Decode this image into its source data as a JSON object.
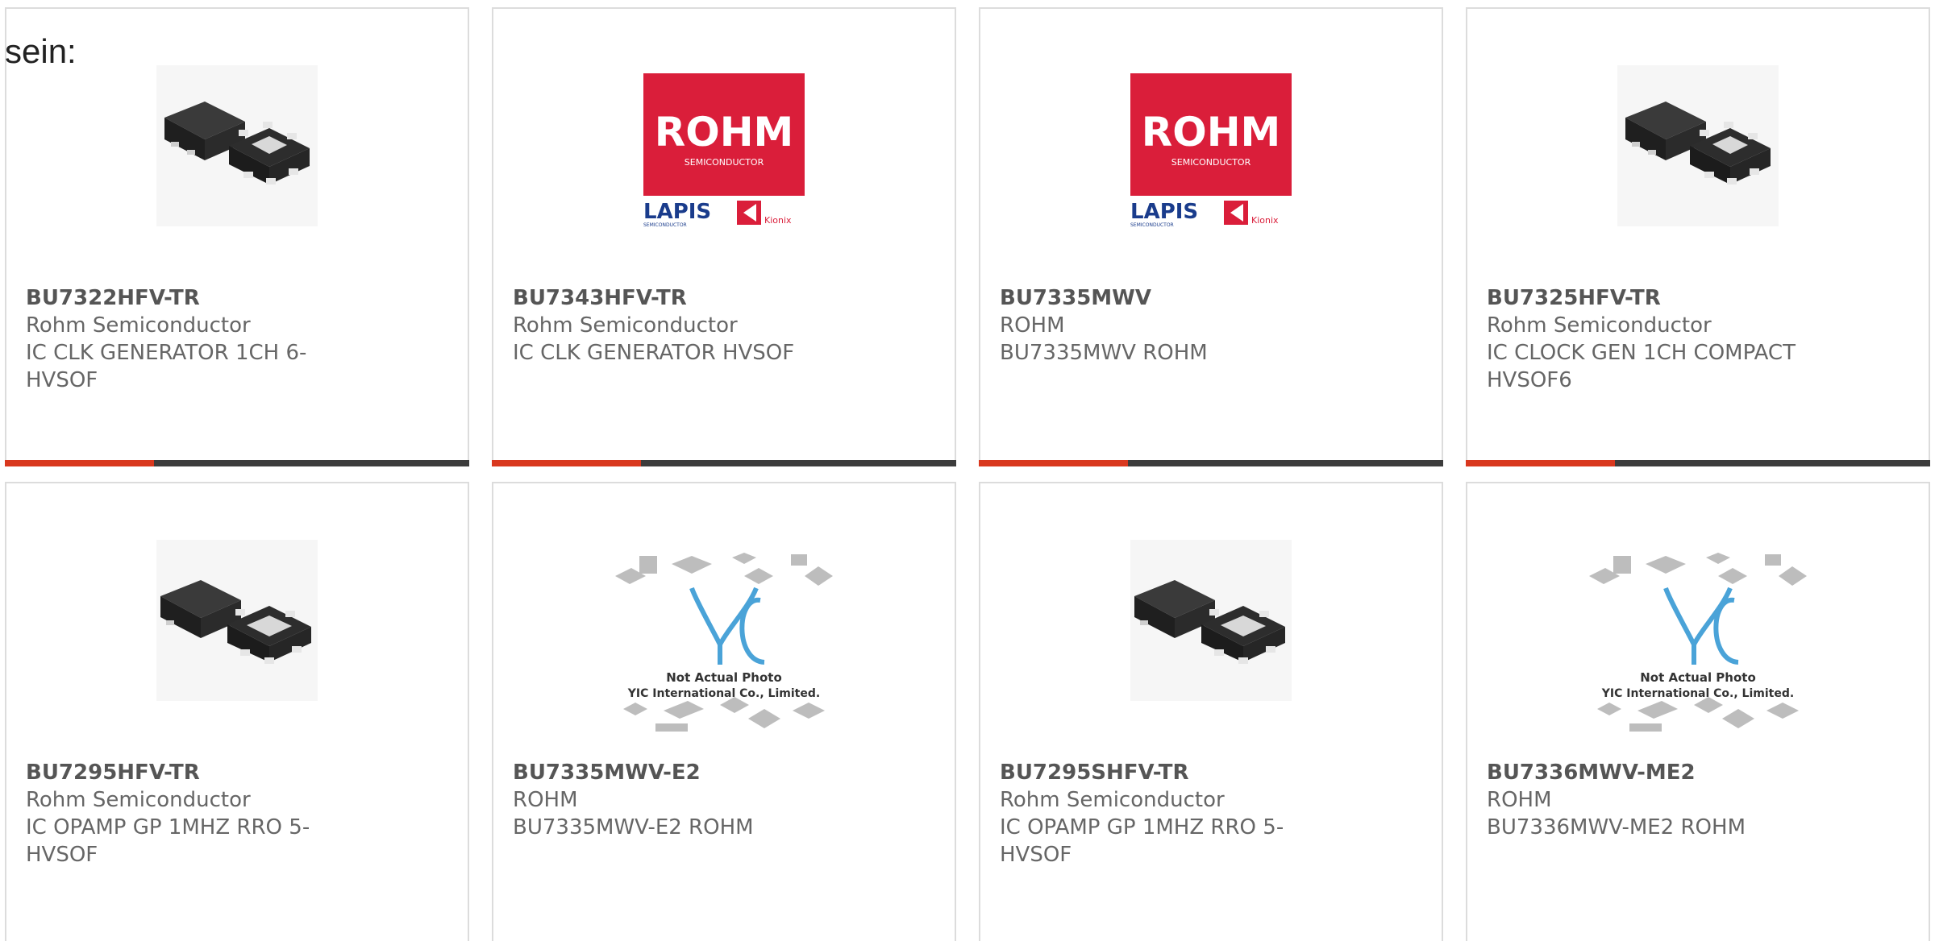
{
  "intro_text": "sein:",
  "colors": {
    "accent": "#d9381e",
    "bar_dark": "#3c3c3c",
    "rohm_red": "#da1e3a",
    "lapis_blue": "#1a3c8c",
    "yic_blue": "#4aa3d8"
  },
  "products": [
    {
      "part": "BU7322HFV-TR",
      "manufacturer": "Rohm Semiconductor",
      "description": "IC CLK GENERATOR 1CH 6-\nHVSOF",
      "image": "chip-6pin-icon"
    },
    {
      "part": "BU7343HFV-TR",
      "manufacturer": "Rohm Semiconductor",
      "description": "IC CLK GENERATOR HVSOF",
      "image": "rohm-logo-icon",
      "logo_text": {
        "brand": "ROHM",
        "sub": "SEMICONDUCTOR",
        "lapis": "LAPIS",
        "lapis_sub": "SEMICONDUCTOR",
        "kionix": "Kionix"
      }
    },
    {
      "part": "BU7335MWV",
      "manufacturer": "ROHM",
      "description": "BU7335MWV ROHM",
      "image": "rohm-logo-icon",
      "logo_text": {
        "brand": "ROHM",
        "sub": "SEMICONDUCTOR",
        "lapis": "LAPIS",
        "lapis_sub": "SEMICONDUCTOR",
        "kionix": "Kionix"
      }
    },
    {
      "part": "BU7325HFV-TR",
      "manufacturer": "Rohm Semiconductor",
      "description": "IC CLOCK GEN 1CH COMPACT\nHVSOF6",
      "image": "chip-6pin-icon"
    },
    {
      "part": "BU7295HFV-TR",
      "manufacturer": "Rohm Semiconductor",
      "description": "IC OPAMP GP 1MHZ RRO 5-\nHVSOF",
      "image": "chip-5pin-icon"
    },
    {
      "part": "BU7335MWV-E2",
      "manufacturer": "ROHM",
      "description": "BU7335MWV-E2 ROHM",
      "image": "yic-placeholder-icon",
      "placeholder_text": {
        "line1": "Not Actual Photo",
        "line2": "YIC International Co., Limited."
      }
    },
    {
      "part": "BU7295SHFV-TR",
      "manufacturer": "Rohm Semiconductor",
      "description": "IC OPAMP GP 1MHZ RRO 5-\nHVSOF",
      "image": "chip-5pin-icon"
    },
    {
      "part": "BU7336MWV-ME2",
      "manufacturer": "ROHM",
      "description": "BU7336MWV-ME2 ROHM",
      "image": "yic-placeholder-icon",
      "placeholder_text": {
        "line1": "Not Actual Photo",
        "line2": "YIC International Co., Limited."
      }
    }
  ]
}
